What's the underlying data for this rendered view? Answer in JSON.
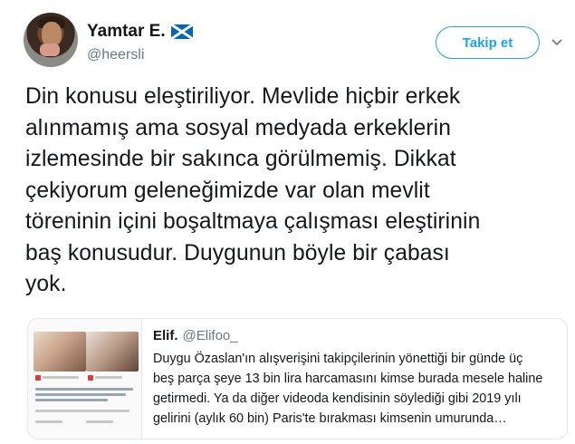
{
  "author": {
    "display_name": "Yamtar E.",
    "flag_icon": "scotland-flag-icon",
    "handle": "@heersli"
  },
  "actions": {
    "follow_label": "Takip et"
  },
  "tweet": {
    "lines": [
      "Din konusu eleştiriliyor. Mevlide hiçbir erkek",
      "alınmamış ama sosyal medyada erkeklerin",
      "izlemesinde bir sakınca görülmemiş. Dikkat",
      "çekiyorum geleneğimizde var olan mevlit",
      "töreninin içini boşaltmaya çalışması eleştirinin",
      "baş konusudur. Duygunun böyle bir çabası",
      "yok."
    ]
  },
  "quoted_tweet": {
    "display_name": "Elif.",
    "handle": "@Elifoo_",
    "lines": [
      "Duygu Özaslan'ın alışverişini takipçilerinin yönettiği bir günde üç",
      "beş parça şeye 13 bin lira harcamasını kimse burada mesele haline",
      "getirmedi. Ya da diğer videoda kendisinin söylediği gibi 2019 yılı",
      "gelirini (aylık 60 bin) Paris'te bırakması kimsenin umurunda…"
    ]
  },
  "colors": {
    "accent": "#1da1f2",
    "secondary_text": "#657786",
    "border": "#e1e8ed"
  }
}
